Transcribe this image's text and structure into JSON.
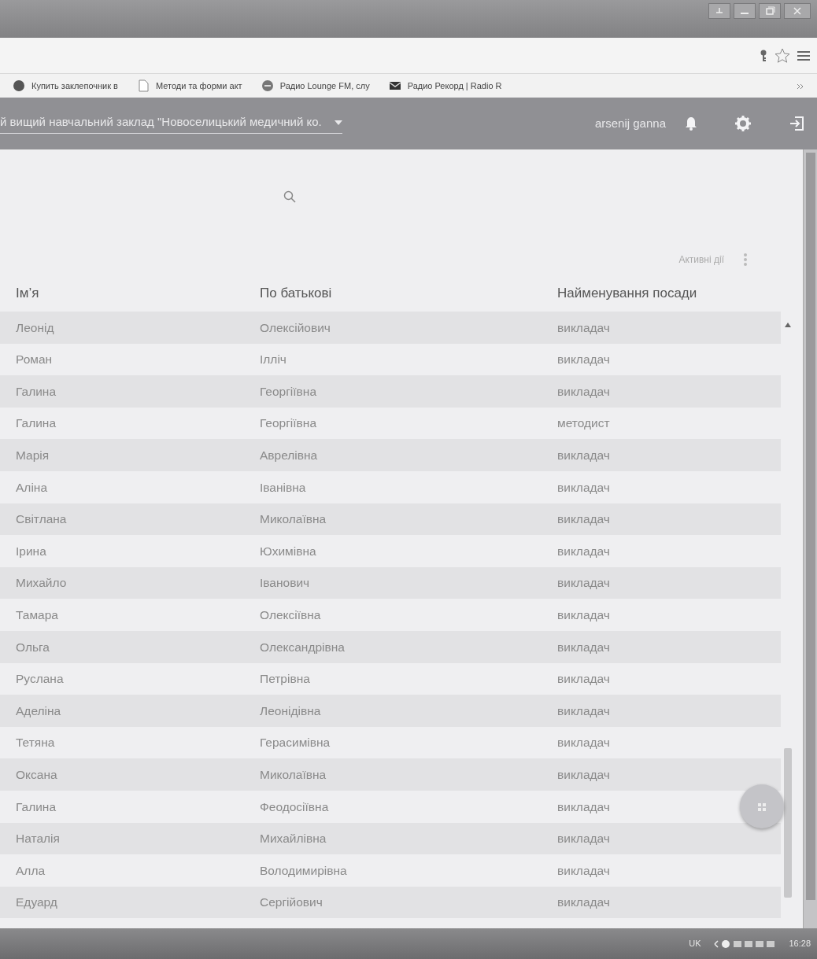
{
  "bookmarks": [
    {
      "kind": "blob",
      "label": "Купить заклепочник в"
    },
    {
      "kind": "page",
      "label": "Методи та форми акт"
    },
    {
      "kind": "radio",
      "label": "Радио Lounge FM, слу"
    },
    {
      "kind": "envelope",
      "label": "Радио Рекорд | Radio R"
    }
  ],
  "header": {
    "organization": "й вищий навчальний заклад \"Новоселицький медичний ко.",
    "user": "arsenij ganna"
  },
  "actions": {
    "label": "Активні дії"
  },
  "table": {
    "columns": [
      "Ім’я",
      "По батькові",
      "Найменування посади"
    ],
    "rows": [
      [
        "Леонід",
        "Олексійович",
        "викладач"
      ],
      [
        "Роман",
        "Ілліч",
        "викладач"
      ],
      [
        "Галина",
        "Георгіївна",
        "викладач"
      ],
      [
        "Галина",
        "Георгіївна",
        "методист"
      ],
      [
        "Марія",
        "Аврелівна",
        "викладач"
      ],
      [
        "Аліна",
        "Іванівна",
        "викладач"
      ],
      [
        "Світлана",
        "Миколаївна",
        "викладач"
      ],
      [
        "Ірина",
        "Юхимівна",
        "викладач"
      ],
      [
        "Михайло",
        "Іванович",
        "викладач"
      ],
      [
        "Тамара",
        "Олексіївна",
        "викладач"
      ],
      [
        "Ольга",
        "Олександрівна",
        "викладач"
      ],
      [
        "Руслана",
        "Петрівна",
        "викладач"
      ],
      [
        "Аделіна",
        "Леонідівна",
        "викладач"
      ],
      [
        "Тетяна",
        "Герасимівна",
        "викладач"
      ],
      [
        "Оксана",
        "Миколаївна",
        "викладач"
      ],
      [
        "Галина",
        "Феодосіївна",
        "викладач"
      ],
      [
        "Наталія",
        "Михайлівна",
        "викладач"
      ],
      [
        "Алла",
        "Володимирівна",
        "викладач"
      ],
      [
        "Едуард",
        "Сергійович",
        "викладач"
      ]
    ]
  },
  "taskbar": {
    "language": "UK",
    "time": "16:28"
  }
}
